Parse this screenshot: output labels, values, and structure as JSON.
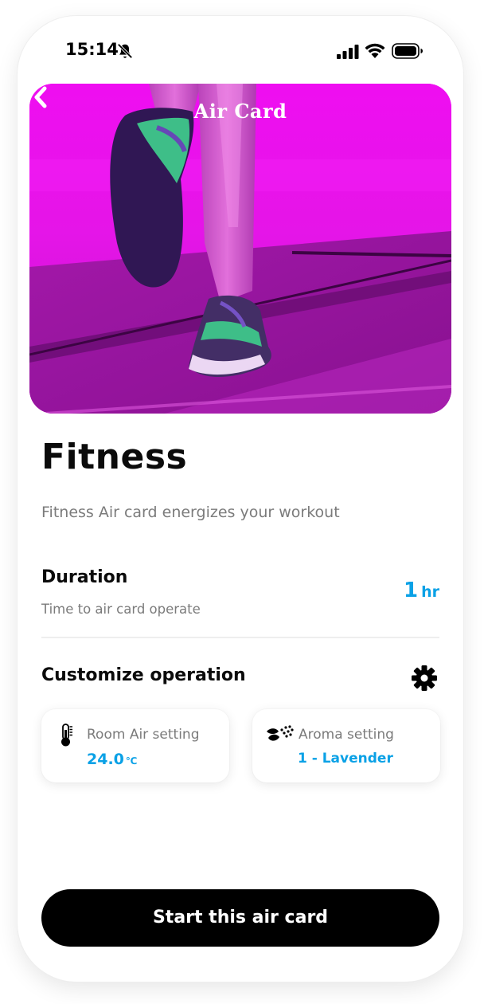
{
  "status_bar": {
    "time": "15:14",
    "icons": [
      "bell-slash-icon",
      "cellular-signal-icon",
      "wifi-icon",
      "battery-icon"
    ]
  },
  "header": {
    "title": "Air Card",
    "back_icon": "chevron-left-icon"
  },
  "hero_image": {
    "description_icon": "running-shoes-treadmill-image",
    "tint_color": "#e612e9"
  },
  "card": {
    "name": "Fitness",
    "description": "Fitness Air card energizes your workout"
  },
  "duration": {
    "label": "Duration",
    "sublabel": "Time to air card operate",
    "value": "1",
    "unit": "hr"
  },
  "customize": {
    "label": "Customize operation",
    "settings_icon": "gear-icon",
    "room_air": {
      "icon": "thermometer-icon",
      "label": "Room Air setting",
      "value": "24.0",
      "unit": "℃"
    },
    "aroma": {
      "icon": "aroma-leaves-icon",
      "label": "Aroma setting",
      "value": "1 - Lavender"
    }
  },
  "actions": {
    "start_label": "Start this air card"
  },
  "colors": {
    "accent": "#0aa1e6",
    "primary_text": "#0b0b0b",
    "secondary_text": "#7b7b7b",
    "button_bg": "#000000"
  }
}
